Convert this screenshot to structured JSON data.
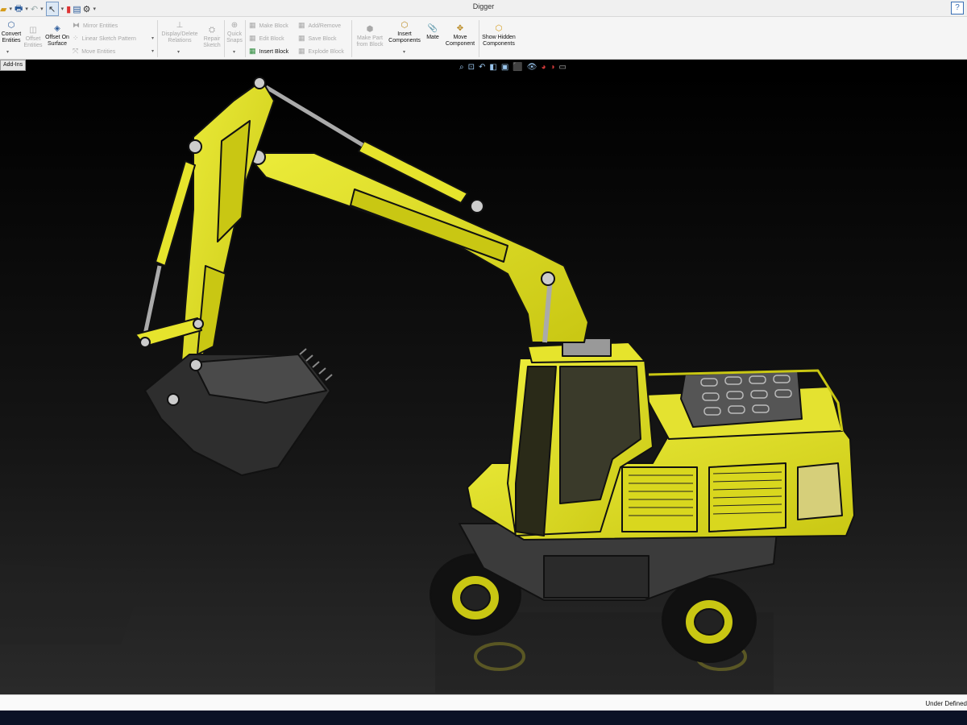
{
  "window": {
    "title": "Digger",
    "help_label": "?"
  },
  "ribbon": {
    "convert_entities": "Convert Entities",
    "offset_entities": "Offset Entities",
    "offset_on_surface": "Offset On Surface",
    "mirror_entities": "Mirror Entities",
    "linear_sketch_pattern": "Linear Sketch Pattern",
    "move_entities": "Move Entities",
    "display_delete_relations": "Display/Delete Relations",
    "repair_sketch": "Repair Sketch",
    "quick_snaps": "Quick Snaps",
    "make_block": "Make Block",
    "edit_block": "Edit Block",
    "insert_block": "Insert Block",
    "add_remove": "Add/Remove",
    "save_block": "Save Block",
    "explode_block": "Explode Block",
    "make_part_from_block": "Make Part from Block",
    "insert_components": "Insert Components",
    "mate": "Mate",
    "move_component": "Move Component",
    "show_hidden_components": "Show Hidden Components"
  },
  "tabs": {
    "addins": "Add-Ins"
  },
  "status": {
    "text": "Under Defined"
  },
  "icons": {
    "viewport": [
      "zoom-to-fit-icon",
      "zoom-to-area-icon",
      "previous-view-icon",
      "section-view-icon",
      "view-orientation-icon",
      "display-style-icon",
      "hide-show-icon",
      "edit-appearance-icon",
      "apply-scene-icon",
      "view-settings-icon"
    ]
  },
  "colors": {
    "body": "#e0de1c",
    "background": "#000000",
    "ribbon": "#f5f5f5"
  }
}
